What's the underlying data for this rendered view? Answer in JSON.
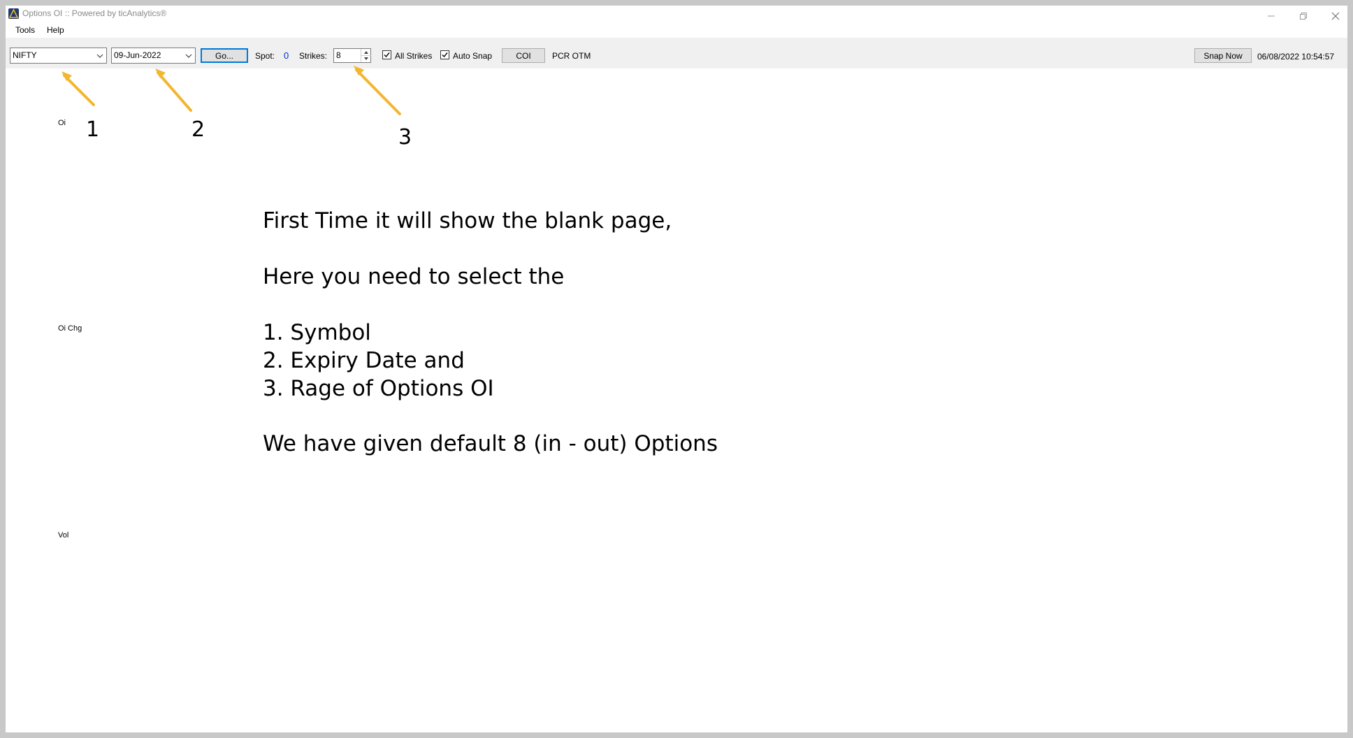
{
  "window": {
    "title": "Options OI :: Powered by ticAnalytics®"
  },
  "menu": {
    "items": [
      "Tools",
      "Help"
    ]
  },
  "toolbar": {
    "symbol": "NIFTY",
    "expiry": "09-Jun-2022",
    "go_label": "Go...",
    "spot_label": "Spot:",
    "spot_value": "0",
    "strikes_label": "Strikes:",
    "strikes_value": "8",
    "all_strikes_label": "All Strikes",
    "all_strikes_checked": true,
    "auto_snap_label": "Auto Snap",
    "auto_snap_checked": true,
    "coi_label": "COI",
    "pcr_label": "PCR OTM",
    "snap_now_label": "Snap Now",
    "timestamp": "06/08/2022 10:54:57"
  },
  "panels": {
    "oi_label": "Oi",
    "oi_chg_label": "Oi Chg",
    "vol_label": "Vol"
  },
  "annotations": {
    "numbers": [
      "1",
      "2",
      "3"
    ],
    "arrow_color": "#f2b630"
  },
  "instructions": {
    "line1": "First Time it will show the blank page,",
    "line2": "Here you need to select the",
    "line3": "1. Symbol",
    "line4": "2. Expiry Date and",
    "line5": "3. Rage of Options OI",
    "line6": "We have given default 8 (in - out) Options"
  }
}
